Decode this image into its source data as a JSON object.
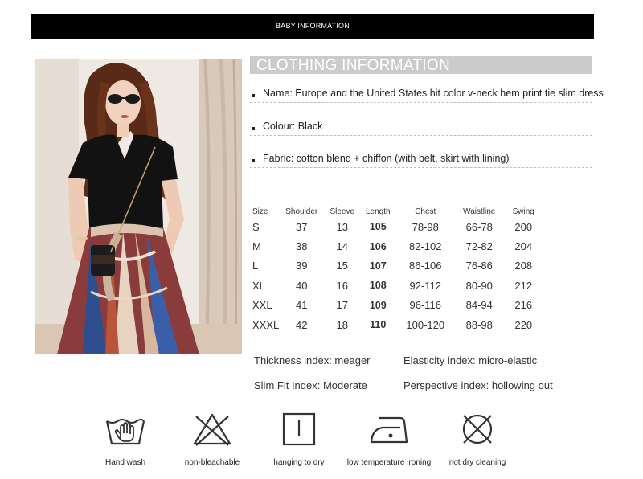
{
  "banner": {
    "title": "BABY INFORMATION"
  },
  "photo": {
    "alt": "model-photo"
  },
  "section": {
    "title": "CLOTHING INFORMATION"
  },
  "info": [
    {
      "text": "Name: Europe and the United States hit color v-neck hem print tie slim dress"
    },
    {
      "text": "Colour: Black"
    },
    {
      "text": "Fabric: cotton blend + chiffon (with belt, skirt with lining)"
    }
  ],
  "size_table": {
    "headers": [
      "Size",
      "Shoulder",
      "Sleeve",
      "Length",
      "Chest",
      "Waistline",
      "Swing"
    ],
    "rows": [
      [
        "S",
        "37",
        "13",
        "105",
        "78-98",
        "66-78",
        "200"
      ],
      [
        "M",
        "38",
        "14",
        "106",
        "82-102",
        "72-82",
        "204"
      ],
      [
        "L",
        "39",
        "15",
        "107",
        "86-106",
        "76-86",
        "208"
      ],
      [
        "XL",
        "40",
        "16",
        "108",
        "92-112",
        "80-90",
        "212"
      ],
      [
        "XXL",
        "41",
        "17",
        "109",
        "96-116",
        "84-94",
        "216"
      ],
      [
        "XXXL",
        "42",
        "18",
        "110",
        "100-120",
        "88-98",
        "220"
      ]
    ]
  },
  "indices": {
    "thickness": "Thickness index: meager",
    "elasticity": "Elasticity index: micro-elastic",
    "fit": "Slim Fit Index: Moderate",
    "perspective": "Perspective index: hollowing out"
  },
  "care": [
    {
      "icon": "hand-wash-icon",
      "label": "Hand wash"
    },
    {
      "icon": "no-bleach-icon",
      "label": "non-bleachable"
    },
    {
      "icon": "hang-dry-icon",
      "label": "hanging to dry"
    },
    {
      "icon": "low-iron-icon",
      "label": "low temperature ironing"
    },
    {
      "icon": "no-dry-clean-icon",
      "label": "not dry cleaning"
    }
  ]
}
